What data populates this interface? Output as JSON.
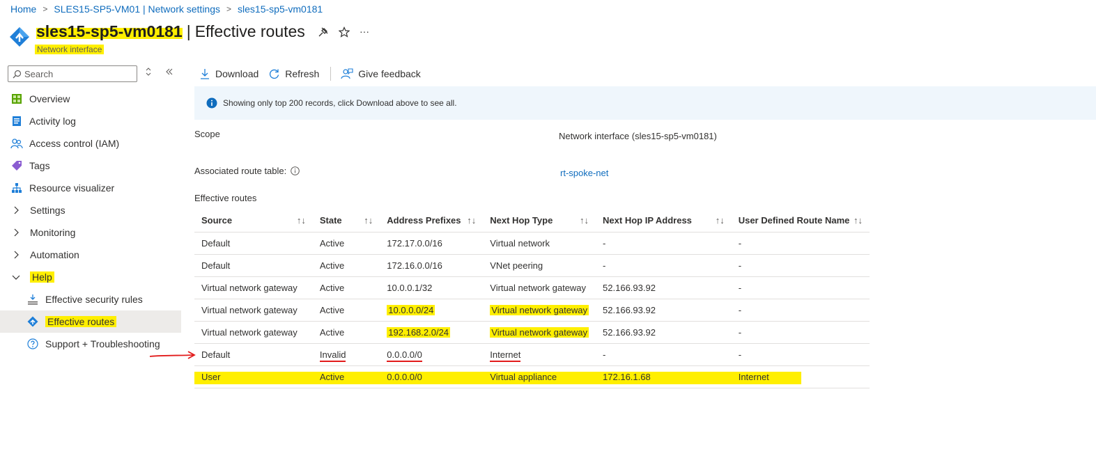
{
  "breadcrumb": {
    "home": "Home",
    "parent": "SLES15-SP5-VM01 | Network settings",
    "current": "sles15-sp5-vm0181"
  },
  "header": {
    "resource_name": "sles15-sp5-vm0181",
    "divider": "|",
    "page_title": "Effective routes",
    "subtitle": "Network interface",
    "more": "···"
  },
  "sidebar": {
    "search_placeholder": "Search",
    "items": [
      {
        "label": "Overview"
      },
      {
        "label": "Activity log"
      },
      {
        "label": "Access control (IAM)"
      },
      {
        "label": "Tags"
      },
      {
        "label": "Resource visualizer"
      },
      {
        "label": "Settings"
      },
      {
        "label": "Monitoring"
      },
      {
        "label": "Automation"
      },
      {
        "label": "Help"
      },
      {
        "label": "Effective security rules"
      },
      {
        "label": "Effective routes"
      },
      {
        "label": "Support + Troubleshooting"
      }
    ]
  },
  "toolbar": {
    "download": "Download",
    "refresh": "Refresh",
    "feedback": "Give feedback"
  },
  "info": {
    "message": "Showing only top 200 records, click Download above to see all."
  },
  "details": {
    "scope_label": "Scope",
    "scope_value": "Network interface (sles15-sp5-vm0181)",
    "route_table_label": "Associated route table:",
    "route_table_value": "rt-spoke-net",
    "section_title": "Effective routes"
  },
  "table": {
    "columns": [
      "Source",
      "State",
      "Address Prefixes",
      "Next Hop Type",
      "Next Hop IP Address",
      "User Defined Route Name"
    ],
    "sort_glyph": "↑↓",
    "rows": [
      [
        "Default",
        "Active",
        "172.17.0.0/16",
        "Virtual network",
        "-",
        "-"
      ],
      [
        "Default",
        "Active",
        "172.16.0.0/16",
        "VNet peering",
        "-",
        "-"
      ],
      [
        "Virtual network gateway",
        "Active",
        "10.0.0.1/32",
        "Virtual network gateway",
        "52.166.93.92",
        "-"
      ],
      [
        "Virtual network gateway",
        "Active",
        "10.0.0.0/24",
        "Virtual network gateway",
        "52.166.93.92",
        "-"
      ],
      [
        "Virtual network gateway",
        "Active",
        "192.168.2.0/24",
        "Virtual network gateway",
        "52.166.93.92",
        "-"
      ],
      [
        "Default",
        "Invalid",
        "0.0.0.0/0",
        "Internet",
        "-",
        "-"
      ],
      [
        "User",
        "Active",
        "0.0.0.0/0",
        "Virtual appliance",
        "172.16.1.68",
        "Internet"
      ]
    ]
  },
  "colors": {
    "accent": "#0f6cbd",
    "highlight": "#ffef00",
    "annotation": "#e21b1b"
  }
}
